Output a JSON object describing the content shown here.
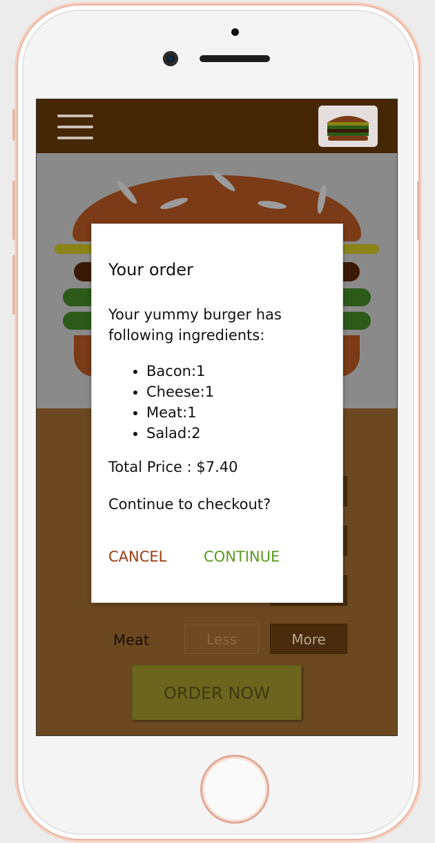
{
  "header": {
    "menu_icon": "hamburger-menu-icon",
    "logo_icon": "burger-logo-icon"
  },
  "controls": [
    {
      "label": "Meat",
      "less": "Less",
      "more": "More"
    }
  ],
  "order_button": "ORDER NOW",
  "modal": {
    "title": "Your order",
    "intro": "Your yummy burger has following ingredients:",
    "ingredients": [
      "Bacon:1",
      "Cheese:1",
      "Meat:1",
      "Salad:2"
    ],
    "total_price": "Total Price : $7.40",
    "question": "Continue to checkout?",
    "cancel_label": "CANCEL",
    "continue_label": "CONTINUE"
  },
  "colors": {
    "header_bg": "#452605",
    "controls_bg": "#6b4820",
    "cancel": "#9a3b10",
    "continue": "#5a9a1e",
    "order_button": "#6b651e"
  }
}
